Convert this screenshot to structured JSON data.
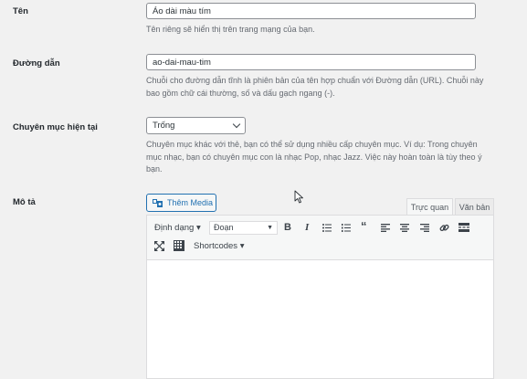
{
  "fields": {
    "name": {
      "label": "Tên",
      "value": "Áo dài màu tím",
      "description": "Tên riêng sẽ hiển thị trên trang mạng của bạn."
    },
    "slug": {
      "label": "Đường dẫn",
      "value": "ao-dai-mau-tim",
      "description": "Chuỗi cho đường dẫn tĩnh là phiên bản của tên hợp chuẩn với Đường dẫn (URL). Chuỗi này bao gồm chữ cái thường, số và dấu gạch ngang (-)."
    },
    "parent": {
      "label": "Chuyên mục hiện tại",
      "selected": "Trống",
      "description": "Chuyên mục khác với thẻ, bạn có thể sử dụng nhiều cấp chuyên mục. Ví dụ: Trong chuyên mục nhạc, bạn có chuyên mục con là nhạc Pop, nhạc Jazz. Việc này hoàn toàn là tùy theo ý bạn."
    },
    "description": {
      "label": "Mô tả"
    }
  },
  "editor": {
    "add_media_label": "Thêm Media",
    "tabs": [
      "Trực quan",
      "Văn bản"
    ],
    "active_tab": "Trực quan",
    "format_menu_label": "Định dạng ▾",
    "paragraph_select": "Đoạn",
    "shortcodes_label": "Shortcodes ▾",
    "icons": {
      "row1": [
        "bold-icon",
        "italic-icon",
        "bullet-list-icon",
        "numbered-list-icon",
        "blockquote-icon",
        "align-left-icon",
        "align-center-icon",
        "align-right-icon",
        "link-icon",
        "read-more-icon"
      ],
      "row2": [
        "fullscreen-icon",
        "toolbar-toggle-icon"
      ]
    }
  },
  "colors": {
    "accent": "#2271b1",
    "background": "#f1f1f1"
  }
}
